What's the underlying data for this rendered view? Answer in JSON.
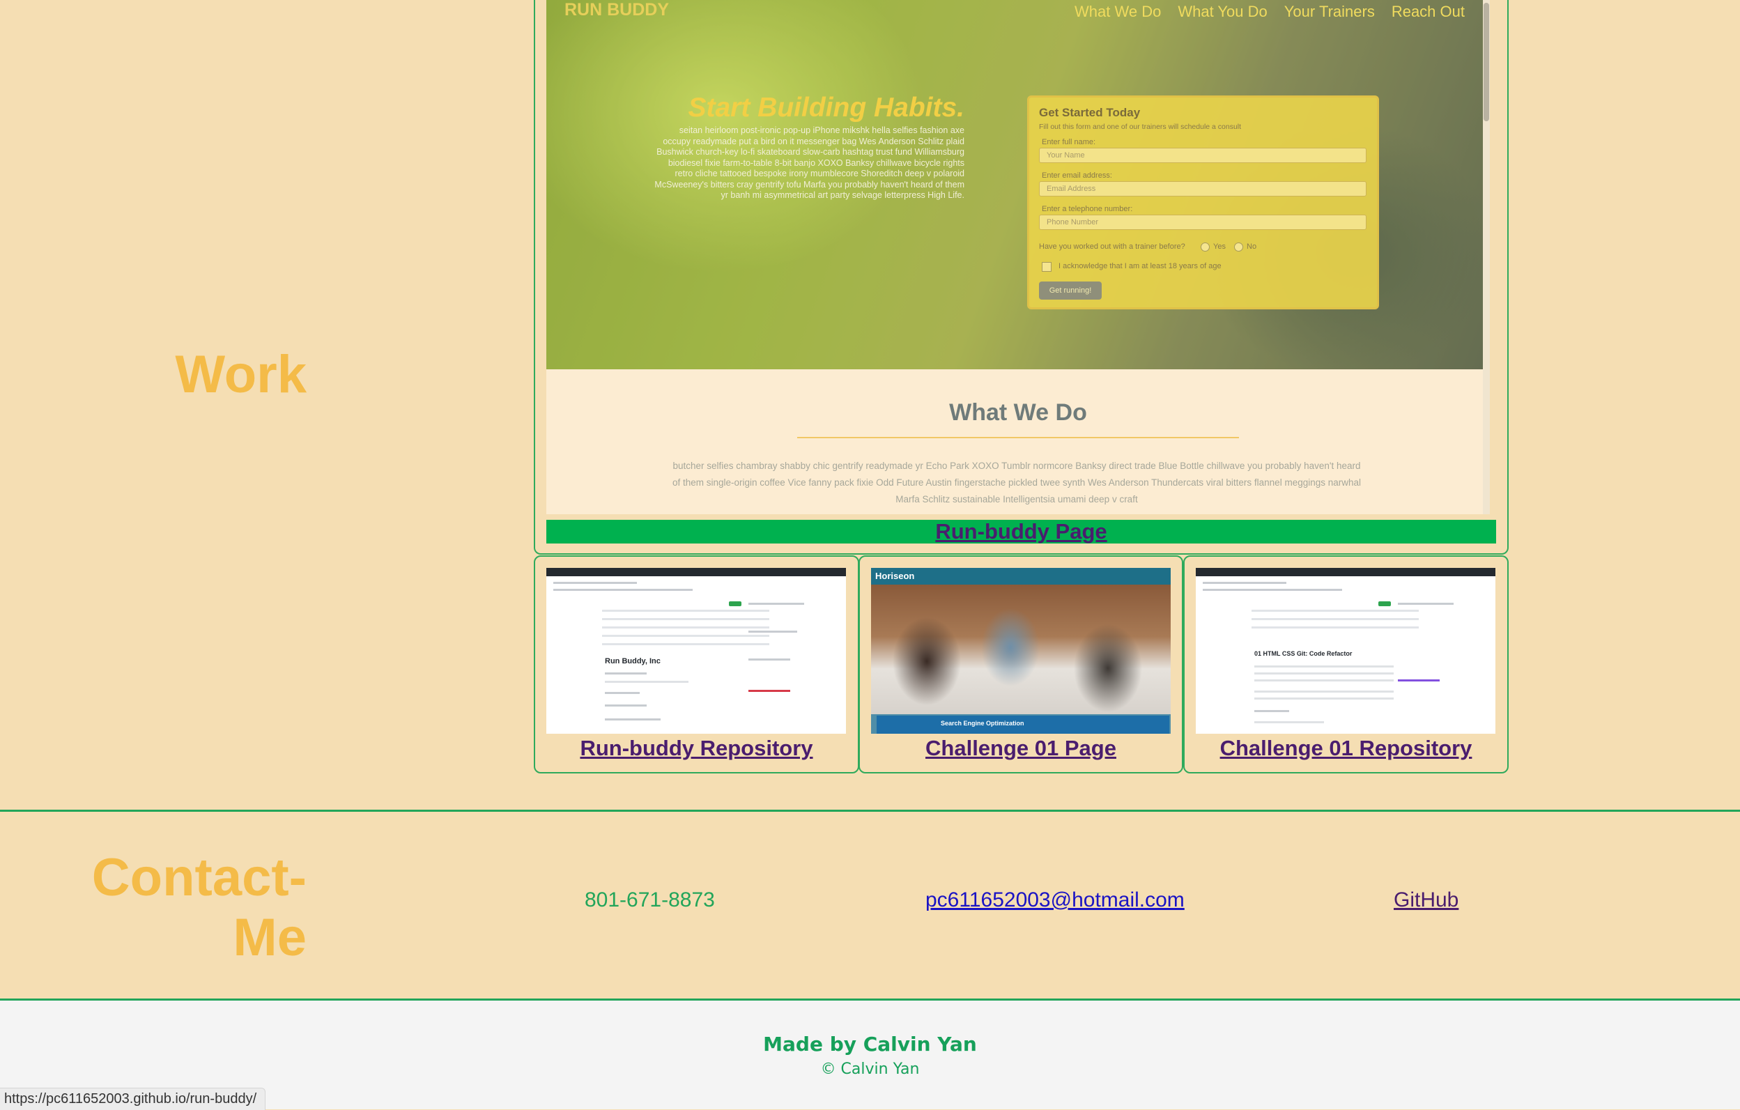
{
  "work": {
    "heading": "Work"
  },
  "preview": {
    "site_logo": "RUN BUDDY",
    "nav": [
      "What We Do",
      "What You Do",
      "Your Trainers",
      "Reach Out"
    ],
    "hero_title": "Start Building Habits.",
    "hero_text": "seitan heirloom post-ironic pop-up iPhone mikshk hella selfies fashion axe occupy readymade put a bird on it messenger bag Wes Anderson Schlitz plaid Bushwick church-key lo-fi skateboard slow-carb hashtag trust fund Williamsburg biodiesel fixie farm-to-table 8-bit banjo XOXO Banksy chillwave bicycle rights retro cliche tattooed bespoke irony mumblecore Shoreditch deep v polaroid McSweeney's bitters cray gentrify tofu Marfa you probably haven't heard of them yr banh mi asymmetrical art party selvage letterpress High Life.",
    "form": {
      "title": "Get Started Today",
      "subtitle": "Fill out this form and one of our trainers will schedule a consult",
      "name_label": "Enter full name:",
      "name_placeholder": "Your Name",
      "email_label": "Enter email address:",
      "email_placeholder": "Email Address",
      "phone_label": "Enter a telephone number:",
      "phone_placeholder": "Phone Number",
      "question": "Have you worked out with a trainer before?",
      "yes": "Yes",
      "no": "No",
      "acknowledge": "I acknowledge that I am at least 18 years of age",
      "button": "Get running!"
    },
    "section_title": "What We Do",
    "section_text": "butcher selfies chambray shabby chic gentrify readymade yr Echo Park XOXO Tumblr normcore Banksy direct trade Blue Bottle chillwave you probably haven't heard of them single-origin coffee Vice fanny pack fixie Odd Future Austin fingerstache pickled twee synth Wes Anderson Thundercats viral bitters flannel meggings narwhal Marfa Schlitz sustainable Intelligentsia umami deep v craft"
  },
  "projects": {
    "main_link": "Run-buddy Page",
    "links": [
      "Run-buddy Repository",
      "Challenge 01 Page",
      "Challenge 01 Repository"
    ],
    "thumb_texts": {
      "repo1_title": "Run Buddy, Inc",
      "hs_logo": "Horiseon",
      "hs_banner": "Search Engine Optimization",
      "repo2_title": "01 HTML CSS Git: Code Refactor"
    }
  },
  "contact": {
    "heading": "Contact-Me",
    "phone": "801-671-8873",
    "email": "pc611652003@hotmail.com",
    "github": "GitHub"
  },
  "footer": {
    "made_by": "Made by Calvin Yan",
    "copyright": "© Calvin Yan"
  },
  "status_bar": {
    "url": "https://pc611652003.github.io/run-buddy/"
  },
  "colors": {
    "background": "#f5deb3",
    "heading": "#f4bb48",
    "accent_green": "#22a55a",
    "link_bar": "#00b14f",
    "visited_link": "#4a1d6e",
    "email_link": "#1a13c4"
  }
}
